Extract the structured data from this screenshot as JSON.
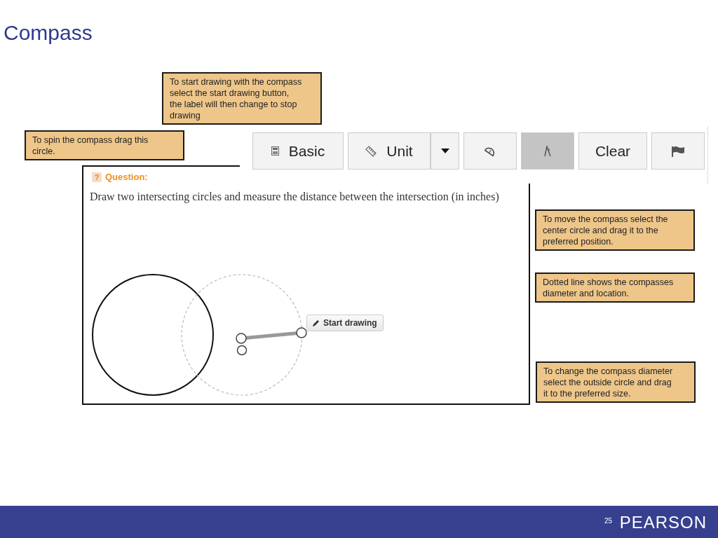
{
  "title": "Compass",
  "callouts": [
    {
      "text": "To start drawing with the compass select the start drawing button, the label will then change to stop drawing"
    },
    {
      "text": "To spin the compass drag this circle."
    },
    {
      "text": "To move the compass select the center circle and drag it to the preferred position."
    },
    {
      "text": "Dotted line shows the compasses diameter and location."
    },
    {
      "text": "To change the compass diameter select the outside circle and drag it to the preferred size."
    }
  ],
  "toolbar": {
    "buttons": [
      {
        "kind": "calculator",
        "label": "Basic",
        "selected": false
      },
      {
        "kind": "ruler",
        "label": "Unit",
        "selected": false
      },
      {
        "kind": "dropdown",
        "selected": false
      },
      {
        "kind": "protractor",
        "selected": false
      },
      {
        "kind": "compass",
        "selected": true
      },
      {
        "kind": "text",
        "label": "Clear",
        "selected": false
      },
      {
        "kind": "flag",
        "selected": false
      }
    ]
  },
  "question": {
    "icon": "?",
    "heading": "Question:",
    "text": "Draw two intersecting circles and measure the distance between the intersection (in inches)"
  },
  "canvas": {
    "button": "Start drawing"
  },
  "footer": {
    "logo": "PEARSON",
    "page": "25"
  }
}
